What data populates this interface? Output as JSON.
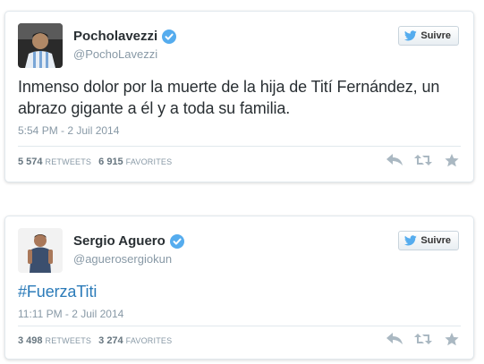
{
  "tweets": [
    {
      "name": "Pocholavezzi",
      "handle": "@PochoLavezzi",
      "follow_label": "Suivre",
      "text": "Inmenso dolor por la muerte de la hija de Tití Fernández, un abrazo gigante a él y a toda su familia.",
      "time": "5:54 PM - 2 Juil 2014",
      "retweets_count": "5 574",
      "retweets_label": "RETWEETS",
      "favorites_count": "6 915",
      "favorites_label": "FAVORITES"
    },
    {
      "name": "Sergio Aguero",
      "handle": "@aguerosergiokun",
      "follow_label": "Suivre",
      "text": "#FuerzaTiti",
      "time": "11:11 PM - 2 Juil 2014",
      "retweets_count": "3 498",
      "retweets_label": "RETWEETS",
      "favorites_count": "3 274",
      "favorites_label": "FAVORITES"
    }
  ],
  "colors": {
    "verified": "#55acee",
    "link": "#2b7bb9",
    "muted": "#8899a6",
    "text": "#292f33"
  },
  "icons": [
    "verified-badge-icon",
    "twitter-bird-icon",
    "reply-icon",
    "retweet-icon",
    "favorite-star-icon"
  ]
}
